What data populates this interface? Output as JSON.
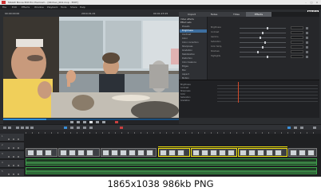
{
  "window": {
    "title": "MAGIX Movie Edit Pro Premium - [Kitchen_004.mvp - EDIT]",
    "minimize": "–",
    "maximize": "□",
    "close": "×"
  },
  "menu": [
    "File",
    "Edit",
    "Effects",
    "Window",
    "Playback",
    "Tools",
    "Share",
    "Help"
  ],
  "brand": {
    "logo": "MAGIX"
  },
  "monitor": {
    "timecode_left": "00:00:00:00",
    "program_label": "2019-01-01",
    "timecode_right": "00:01:23:15"
  },
  "effects_tabs": [
    "Import",
    "Fades",
    "Titles",
    "Effects"
  ],
  "effects_active_tab": "Effects",
  "effects_panel": {
    "header_primary": "Video effects",
    "header_secondary": "Effect sets",
    "items": [
      "Presets",
      "Brightness",
      "Contrast",
      "Color",
      "Color correction",
      "Sharpness",
      "Gradation",
      "Stabilization",
      "Distortion",
      "Color balance",
      "Edges",
      "Blur",
      "Aspect",
      "Motion"
    ],
    "selected": "Brightness",
    "section_footer_1": "Audio effects",
    "section_footer_2": "Movie effects",
    "sliders": [
      {
        "label": "Brightness",
        "value": 0.6
      },
      {
        "label": "Contrast",
        "value": 0.5
      },
      {
        "label": "Gamma",
        "value": 0.45
      },
      {
        "label": "Saturation",
        "value": 0.55
      },
      {
        "label": "Color temp.",
        "value": 0.5
      },
      {
        "label": "Shadows",
        "value": 0.4
      },
      {
        "label": "Highlights",
        "value": 0.6
      }
    ]
  },
  "keyframes": {
    "rows": [
      "Brightness",
      "Contrast",
      "Sharpness",
      "Color",
      "Saturation",
      "Gradation"
    ]
  },
  "tracks": [
    "1",
    "2",
    "3",
    "4",
    "5"
  ],
  "caption": {
    "text": "1865x1038 986kb PNG"
  },
  "colors": {
    "accent_blue": "#2f8fdc",
    "selection_yellow": "#f0e010",
    "audio_green": "#3aa048",
    "playhead_red": "#d24a2a"
  }
}
